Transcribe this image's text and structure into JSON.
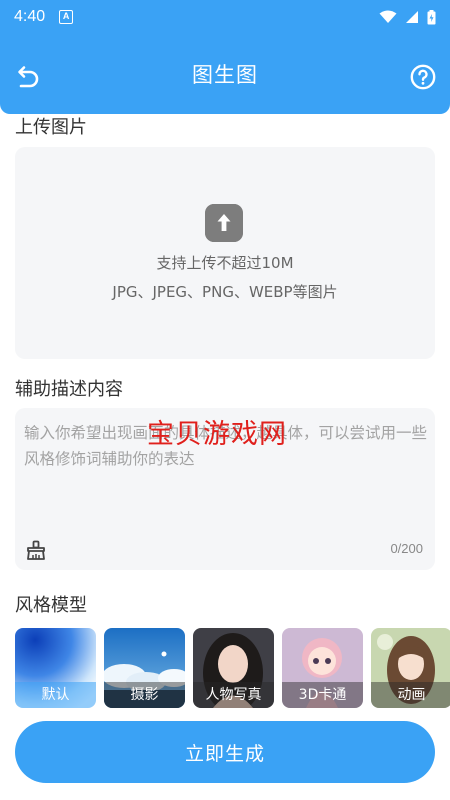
{
  "status_bar": {
    "time": "4:40",
    "app_icon_letter": "A"
  },
  "header": {
    "title": "图生图"
  },
  "upload": {
    "section_title": "上传图片",
    "hint_line1": "支持上传不超过10M",
    "hint_line2": "JPG、JPEG、PNG、WEBP等图片"
  },
  "description": {
    "section_title": "辅助描述内容",
    "value": "",
    "placeholder": "输入你希望出现画面的具体描述，越具体，可以尝试用一些风格修饰词辅助你的表达",
    "char_count": "0/200"
  },
  "watermark": {
    "text": "宝贝游戏网"
  },
  "style_model": {
    "section_title": "风格模型",
    "selected": "默认",
    "items": [
      {
        "label": "默认"
      },
      {
        "label": "摄影"
      },
      {
        "label": "人物写真"
      },
      {
        "label": "3D卡通"
      },
      {
        "label": "动画"
      }
    ]
  },
  "generate_button": {
    "label": "立即生成"
  },
  "colors": {
    "primary": "#3aa2f5",
    "panel_bg": "#f5f6f8",
    "watermark": "#e0201c"
  }
}
